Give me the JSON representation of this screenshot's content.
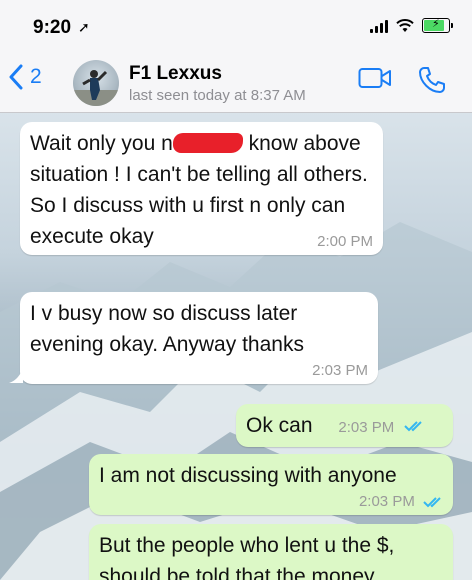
{
  "status_bar": {
    "time": "9:20",
    "location_arrow": "location-arrow-icon"
  },
  "header": {
    "back_count": "2",
    "contact_name": "F1 Lexxus",
    "last_seen": "last seen today at 8:37 AM"
  },
  "colors": {
    "accent": "#1a7df5",
    "incoming_bubble": "#ffffff",
    "outgoing_bubble": "#dcf8c6",
    "read_ticks": "#34b7f1",
    "redaction": "#e8202a"
  },
  "messages": [
    {
      "direction": "in",
      "text_before": "Wait only you n",
      "text_after": " know above situation ! I can't be telling all others. So I discuss with u first n only can execute okay",
      "time": "2:00 PM"
    },
    {
      "direction": "in",
      "text": "I v busy now so discuss later evening okay. Anyway thanks",
      "time": "2:03 PM"
    },
    {
      "direction": "out",
      "text": "Ok can",
      "time": "2:03 PM",
      "status": "read"
    },
    {
      "direction": "out",
      "text": "I am not discussing with anyone",
      "time": "2:03 PM",
      "status": "read"
    },
    {
      "direction": "out",
      "text": "But the people who lent u the $, should be told that the money",
      "time": ""
    }
  ]
}
